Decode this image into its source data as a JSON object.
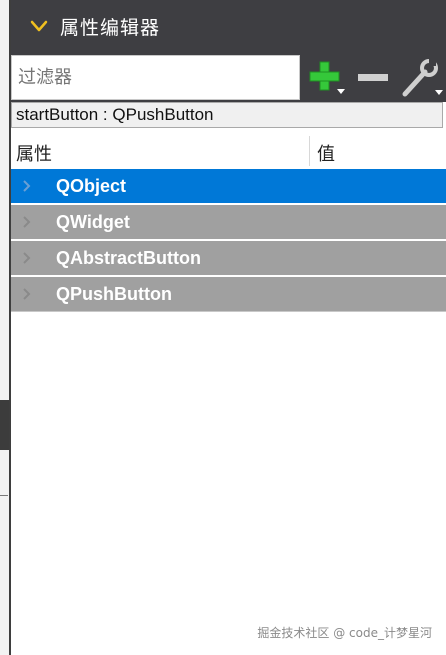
{
  "header": {
    "title": "属性编辑器",
    "collapse_icon": "chevron-down-icon",
    "accent": "#f0c020"
  },
  "filter": {
    "placeholder": "过滤器",
    "value": ""
  },
  "toolbar": {
    "add_icon": "plus-icon",
    "remove_icon": "minus-icon",
    "settings_icon": "wrench-icon"
  },
  "object_name": "startButton : QPushButton",
  "columns": {
    "property": "属性",
    "value": "值"
  },
  "rows": [
    {
      "label": "QObject",
      "selected": true
    },
    {
      "label": "QWidget",
      "selected": false
    },
    {
      "label": "QAbstractButton",
      "selected": false
    },
    {
      "label": "QPushButton",
      "selected": false
    }
  ],
  "watermark": "掘金技术社区 @ code_计梦星河",
  "colors": {
    "selected_row": "#0078d7",
    "group_row": "#a0a0a0",
    "header_bg": "#3e3e42"
  }
}
